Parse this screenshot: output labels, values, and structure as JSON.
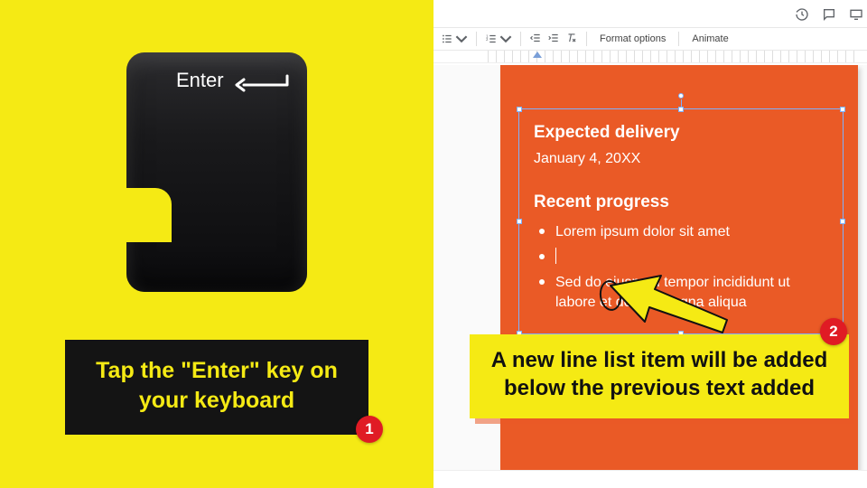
{
  "left": {
    "key_label": "Enter",
    "caption": "Tap the \"Enter\" key on your keyboard",
    "badge": "1"
  },
  "right": {
    "toolbar": {
      "format_options": "Format options",
      "animate": "Animate"
    },
    "slide": {
      "heading1": "Expected delivery",
      "date": "January 4, 20XX",
      "heading2": "Recent progress",
      "bullets": [
        "Lorem ipsum dolor sit amet",
        "",
        "Sed do eiusmod tempor incididunt ut labore et dolore magna aliqua"
      ]
    },
    "caption": "A new line list item will be added below the previous text added",
    "badge": "2"
  }
}
